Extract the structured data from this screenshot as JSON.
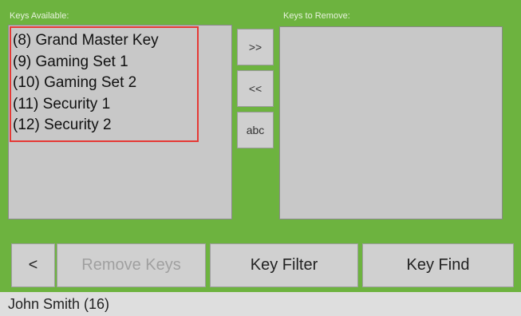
{
  "available_panel": {
    "label": "Keys Available:",
    "items": [
      {
        "label": "(8) Grand Master Key"
      },
      {
        "label": "(9) Gaming Set 1"
      },
      {
        "label": "(10) Gaming Set 2"
      },
      {
        "label": "(11) Security 1"
      },
      {
        "label": "(12) Security 2"
      }
    ]
  },
  "remove_panel": {
    "label": "Keys to Remove:"
  },
  "transfer_buttons": {
    "add_all": ">>",
    "remove_all": "<<",
    "sort": "abc"
  },
  "bottom_bar": {
    "back": "<",
    "remove_keys": "Remove Keys",
    "key_filter": "Key Filter",
    "key_find": "Key Find"
  },
  "status": {
    "user": "John Smith (16)"
  },
  "colors": {
    "background": "#6db33f",
    "listbox": "#c8c8c8",
    "highlight_border": "#e53935",
    "status_bar": "#dedede"
  }
}
